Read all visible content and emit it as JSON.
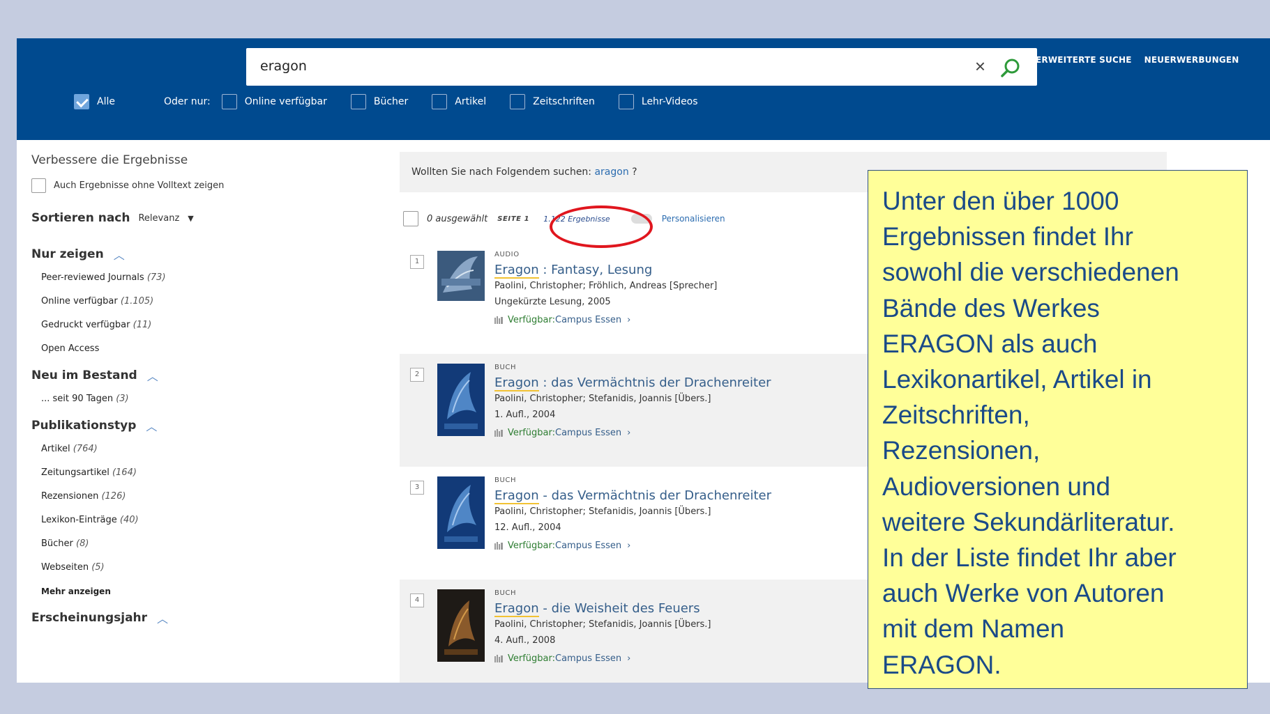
{
  "search": {
    "query": "eragon",
    "clear_glyph": "×"
  },
  "top_links": [
    "ERWEITERTE SUCHE",
    "NEUERWERBUNGEN"
  ],
  "filters": {
    "all_label": "Alle",
    "or_only_label": "Oder nur:",
    "options": [
      "Online verfügbar",
      "Bücher",
      "Artikel",
      "Zeitschriften",
      "Lehr-Videos"
    ]
  },
  "sidebar": {
    "refine_title": "Verbessere die Ergebnisse",
    "fulltext_label": "Auch Ergebnisse ohne Volltext zeigen",
    "sort_label": "Sortieren nach",
    "sort_value": "Relevanz",
    "facets": [
      {
        "title": "Nur zeigen",
        "items": [
          {
            "label": "Peer-reviewed Journals",
            "count": "(73)"
          },
          {
            "label": "Online verfügbar",
            "count": "(1.105)"
          },
          {
            "label": "Gedruckt verfügbar",
            "count": "(11)"
          },
          {
            "label": "Open Access",
            "count": ""
          }
        ]
      },
      {
        "title": "Neu im Bestand",
        "items": [
          {
            "label": "... seit 90 Tagen",
            "count": "(3)"
          }
        ]
      },
      {
        "title": "Publikationstyp",
        "items": [
          {
            "label": "Artikel",
            "count": "(764)"
          },
          {
            "label": "Zeitungsartikel",
            "count": "(164)"
          },
          {
            "label": "Rezensionen",
            "count": "(126)"
          },
          {
            "label": "Lexikon-Einträge",
            "count": "(40)"
          },
          {
            "label": "Bücher",
            "count": "(8)"
          },
          {
            "label": "Webseiten",
            "count": "(5)"
          }
        ],
        "more_label": "Mehr anzeigen"
      },
      {
        "title": "Erscheinungsjahr",
        "items": []
      }
    ]
  },
  "suggestion": {
    "prefix": "Wollten Sie nach Folgendem suchen:",
    "term": "aragon",
    "suffix": "?"
  },
  "toolbar": {
    "selected": "0 ausgewählt",
    "page": "SEITE 1",
    "results": "1.122 Ergebnisse",
    "personalize": "Personalisieren"
  },
  "results": [
    {
      "num": "1",
      "type": "AUDIO",
      "title_hl": "Eragon",
      "title_rest": " : Fantasy, Lesung",
      "authors": "Paolini, Christopher; Fröhlich, Andreas [Sprecher]",
      "edition": "Ungekürzte Lesung, 2005",
      "avail_label": "Verfügbar:",
      "avail_loc": " Campus Essen",
      "arrow": "›"
    },
    {
      "num": "2",
      "type": "BUCH",
      "title_hl": "Eragon",
      "title_rest": " : das Vermächtnis der Drachenreiter",
      "authors": "Paolini, Christopher; Stefanidis, Joannis [Übers.]",
      "edition": "1. Aufl., 2004",
      "avail_label": "Verfügbar:",
      "avail_loc": " Campus Essen",
      "arrow": "›"
    },
    {
      "num": "3",
      "type": "BUCH",
      "title_hl": "Eragon",
      "title_rest": " - das Vermächtnis der Drachenreiter",
      "authors": "Paolini, Christopher; Stefanidis, Joannis [Übers.]",
      "edition": "12. Aufl., 2004",
      "avail_label": "Verfügbar:",
      "avail_loc": " Campus Essen",
      "arrow": "›"
    },
    {
      "num": "4",
      "type": "BUCH",
      "title_hl": "Eragon",
      "title_rest": " - die Weisheit des Feuers",
      "authors": "Paolini, Christopher; Stefanidis, Joannis [Übers.]",
      "edition": "4. Aufl., 2008",
      "avail_label": "Verfügbar:",
      "avail_loc": " Campus Essen",
      "arrow": "›"
    }
  ],
  "callout": {
    "lines": [
      "Unter den über 1000",
      "Ergebnissen findet Ihr",
      "sowohl die verschiedenen",
      "Bände des Werkes",
      "ERAGON als auch",
      "Lexikonartikel, Artikel in",
      "Zeitschriften,",
      "Rezensionen,",
      "Audioversionen und",
      "weitere Sekundärliteratur.",
      "In der Liste findet Ihr aber",
      "auch Werke von Autoren",
      "mit dem Namen",
      "ERAGON."
    ]
  },
  "colors": {
    "header_blue": "#004a8f",
    "callout_yellow": "#ffff99",
    "callout_text": "#1a4a88",
    "highlight_ellipse": "#e0161e",
    "available_green": "#2e7d32"
  }
}
